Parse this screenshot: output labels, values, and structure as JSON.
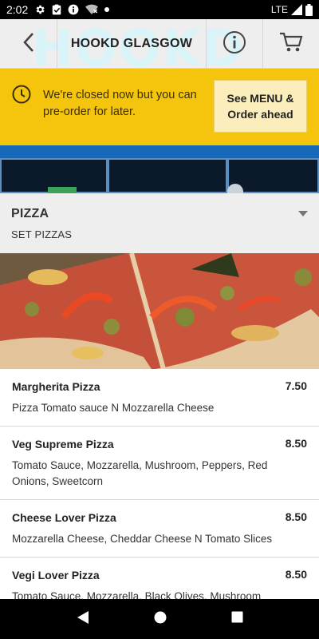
{
  "status_bar": {
    "time": "2:02",
    "network": "LTE"
  },
  "app_bar": {
    "background_logo": "HOOKD",
    "title": "HOOKD GLASGOW",
    "back_icon": "back-arrow-icon",
    "info_icon": "info-icon",
    "cart_icon": "cart-icon"
  },
  "banner": {
    "message": "We're closed now but you can pre-order for later.",
    "button_label": "See MENU & Order ahead",
    "background_color": "#f5c40d"
  },
  "category": {
    "title": "PIZZA",
    "subtitle": "SET PIZZAS"
  },
  "menu_items": [
    {
      "name": "Margherita Pizza",
      "price": "7.50",
      "description": "Pizza Tomato sauce N Mozzarella Cheese"
    },
    {
      "name": "Veg Supreme Pizza",
      "price": "8.50",
      "description": "Tomato Sauce, Mozzarella, Mushroom, Peppers, Red Onions, Sweetcorn"
    },
    {
      "name": "Cheese Lover Pizza",
      "price": "8.50",
      "description": "Mozzarella Cheese, Cheddar Cheese N Tomato Slices"
    },
    {
      "name": "Vegi Lover Pizza",
      "price": "8.50",
      "description": "Tomato Sauce, Mozzarella, Black Olives, Mushroom"
    }
  ]
}
